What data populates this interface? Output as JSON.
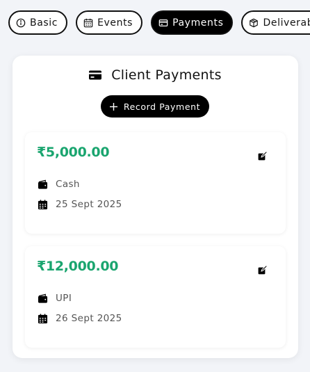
{
  "tabs": [
    {
      "label": "Basic",
      "icon": "info-circle-icon",
      "active": false
    },
    {
      "label": "Events",
      "icon": "calendar-icon",
      "active": false
    },
    {
      "label": "Payments",
      "icon": "credit-card-icon",
      "active": true
    },
    {
      "label": "Deliverab",
      "icon": "package-icon",
      "active": false
    }
  ],
  "panel": {
    "title": "Client Payments",
    "title_icon": "credit-card-icon",
    "record_button_label": "Record Payment"
  },
  "payments": [
    {
      "amount": "₹5,000.00",
      "method": "Cash",
      "date": "25 Sept 2025"
    },
    {
      "amount": "₹12,000.00",
      "method": "UPI",
      "date": "26 Sept 2025"
    }
  ],
  "colors": {
    "accent_amount": "#1aa56f",
    "active_tab_bg": "#000000",
    "page_bg": "#f2f4f8"
  }
}
